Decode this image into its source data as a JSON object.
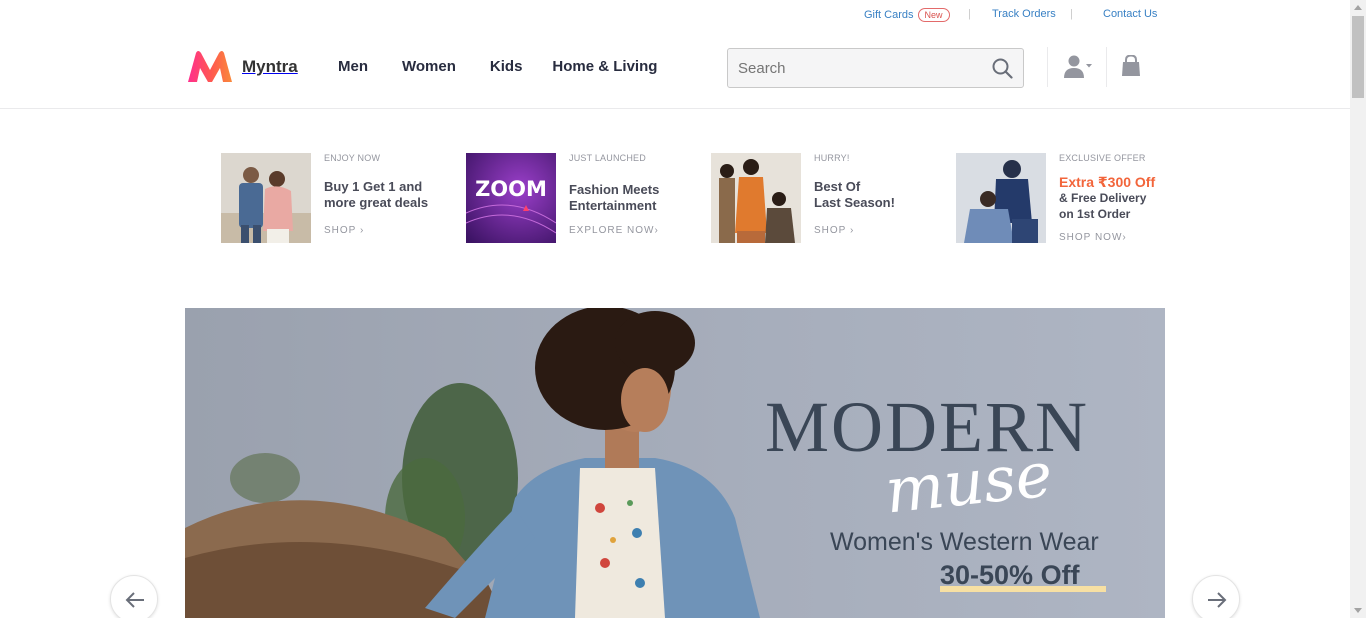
{
  "utility": {
    "gift_cards": "Gift Cards",
    "new_badge": "New",
    "track_orders": "Track Orders",
    "contact_us": "Contact Us",
    "separator": "|"
  },
  "header": {
    "brand": "Myntra",
    "nav": [
      "Men",
      "Women",
      "Kids",
      "Home & Living"
    ],
    "search_placeholder": "Search"
  },
  "promos": [
    {
      "kicker": "ENJOY NOW",
      "title_l1": "Buy 1 Get 1 and",
      "title_l2": "more great deals",
      "cta": "SHOP ›"
    },
    {
      "kicker": "JUST LAUNCHED",
      "title_l1": "Fashion Meets",
      "title_l2": "Entertainment",
      "cta": "EXPLORE NOW›",
      "thumb_text": "ZOOM"
    },
    {
      "kicker": "HURRY!",
      "title_l1": "Best Of",
      "title_l2": "Last Season!",
      "cta": "SHOP ›"
    },
    {
      "kicker": "EXCLUSIVE OFFER",
      "highlight": "Extra ₹300 Off",
      "title_l1": "& Free Delivery",
      "title_l2": "on 1st Order",
      "cta": "SHOP NOW›"
    }
  ],
  "hero": {
    "title": "MODERN",
    "script": "muse",
    "subtitle": "Women's Western Wear",
    "offer": "30-50% Off"
  },
  "colors": {
    "brand_pink": "#ff3f6c",
    "brand_orange": "#f58a3d",
    "link_blue": "#3880c4",
    "offer_orange": "#f2653b"
  }
}
